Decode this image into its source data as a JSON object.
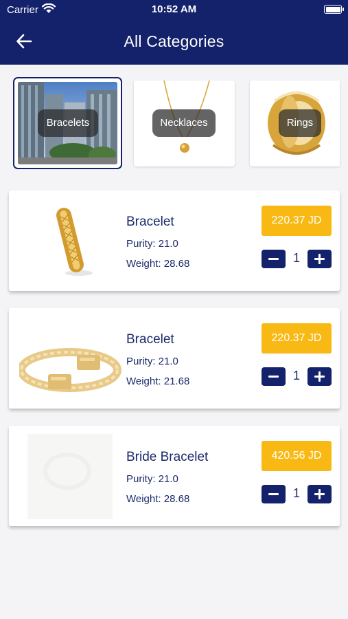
{
  "status_bar": {
    "carrier": "Carrier",
    "time": "10:52 AM"
  },
  "header": {
    "title": "All Categories",
    "back_icon": "arrow-left-icon"
  },
  "categories": [
    {
      "label": "Bracelets",
      "selected": true
    },
    {
      "label": "Necklaces",
      "selected": false
    },
    {
      "label": "Rings",
      "selected": false
    }
  ],
  "products": [
    {
      "name": "Bracelet",
      "purity": "Purity: 21.0",
      "weight": "Weight: 28.68",
      "price": "220.37 JD",
      "quantity": "1"
    },
    {
      "name": "Bracelet",
      "purity": "Purity: 21.0",
      "weight": "Weight: 21.68",
      "price": "220.37 JD",
      "quantity": "1"
    },
    {
      "name": "Bride Bracelet",
      "purity": "Purity: 21.0",
      "weight": "Weight: 28.68",
      "price": "420.56 JD",
      "quantity": "1"
    }
  ],
  "colors": {
    "header": "#13226b",
    "price": "#f9b914",
    "text": "#1b2a6b",
    "background": "#f4f4f6"
  }
}
